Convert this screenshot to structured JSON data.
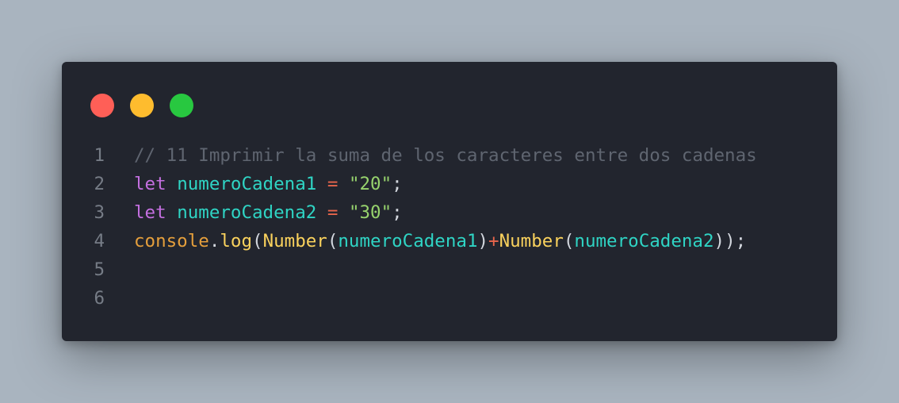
{
  "window": {
    "controls": [
      {
        "name": "close",
        "color": "#ff5f57"
      },
      {
        "name": "minimize",
        "color": "#febc2e"
      },
      {
        "name": "maximize",
        "color": "#28c840"
      }
    ]
  },
  "code": {
    "lines": [
      {
        "number": "1",
        "tokens": [
          {
            "text": "// 11 Imprimir la suma de los caracteres entre dos cadenas",
            "type": "comment"
          }
        ]
      },
      {
        "number": "2",
        "tokens": [
          {
            "text": "let",
            "type": "keyword"
          },
          {
            "text": " ",
            "type": "punct"
          },
          {
            "text": "numeroCadena1",
            "type": "var"
          },
          {
            "text": " ",
            "type": "punct"
          },
          {
            "text": "=",
            "type": "op"
          },
          {
            "text": " ",
            "type": "punct"
          },
          {
            "text": "\"20\"",
            "type": "str"
          },
          {
            "text": ";",
            "type": "punct"
          }
        ]
      },
      {
        "number": "3",
        "tokens": [
          {
            "text": "let",
            "type": "keyword"
          },
          {
            "text": " ",
            "type": "punct"
          },
          {
            "text": "numeroCadena2",
            "type": "var"
          },
          {
            "text": " ",
            "type": "punct"
          },
          {
            "text": "=",
            "type": "op"
          },
          {
            "text": " ",
            "type": "punct"
          },
          {
            "text": "\"30\"",
            "type": "str"
          },
          {
            "text": ";",
            "type": "punct"
          }
        ]
      },
      {
        "number": "4",
        "tokens": [
          {
            "text": "console",
            "type": "obj"
          },
          {
            "text": ".",
            "type": "punct"
          },
          {
            "text": "log",
            "type": "fn"
          },
          {
            "text": "(",
            "type": "punct"
          },
          {
            "text": "Number",
            "type": "fn"
          },
          {
            "text": "(",
            "type": "punct"
          },
          {
            "text": "numeroCadena1",
            "type": "var"
          },
          {
            "text": ")",
            "type": "punct"
          },
          {
            "text": "+",
            "type": "op"
          },
          {
            "text": "Number",
            "type": "fn"
          },
          {
            "text": "(",
            "type": "punct"
          },
          {
            "text": "numeroCadena2",
            "type": "var"
          },
          {
            "text": "));",
            "type": "punct"
          }
        ]
      },
      {
        "number": "5",
        "tokens": []
      },
      {
        "number": "6",
        "tokens": []
      }
    ]
  }
}
